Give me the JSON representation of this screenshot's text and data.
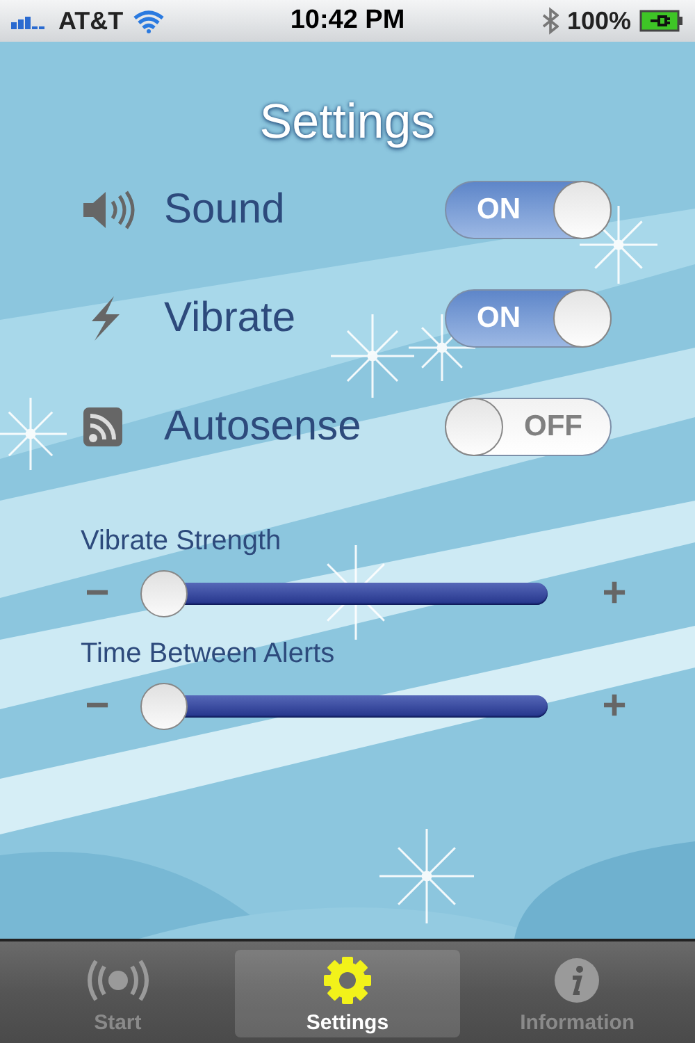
{
  "status_bar": {
    "carrier": "AT&T",
    "time": "10:42 PM",
    "battery": "100%"
  },
  "title": "Settings",
  "toggles": [
    {
      "kind": "speaker",
      "label": "Sound",
      "on": true,
      "state_text": "ON"
    },
    {
      "kind": "bolt",
      "label": "Vibrate",
      "on": true,
      "state_text": "ON"
    },
    {
      "kind": "feed",
      "label": "Autosense",
      "on": false,
      "state_text": "OFF"
    }
  ],
  "sliders": [
    {
      "label": "Vibrate Strength",
      "level": 0,
      "minus": "−",
      "plus": "+"
    },
    {
      "label": "Time Between Alerts",
      "level": 0,
      "minus": "−",
      "plus": "+"
    }
  ],
  "tabs": [
    {
      "kind": "signal",
      "label": "Start",
      "selected": false
    },
    {
      "kind": "gear",
      "label": "Settings",
      "selected": true
    },
    {
      "kind": "info",
      "label": "Information",
      "selected": false
    }
  ]
}
